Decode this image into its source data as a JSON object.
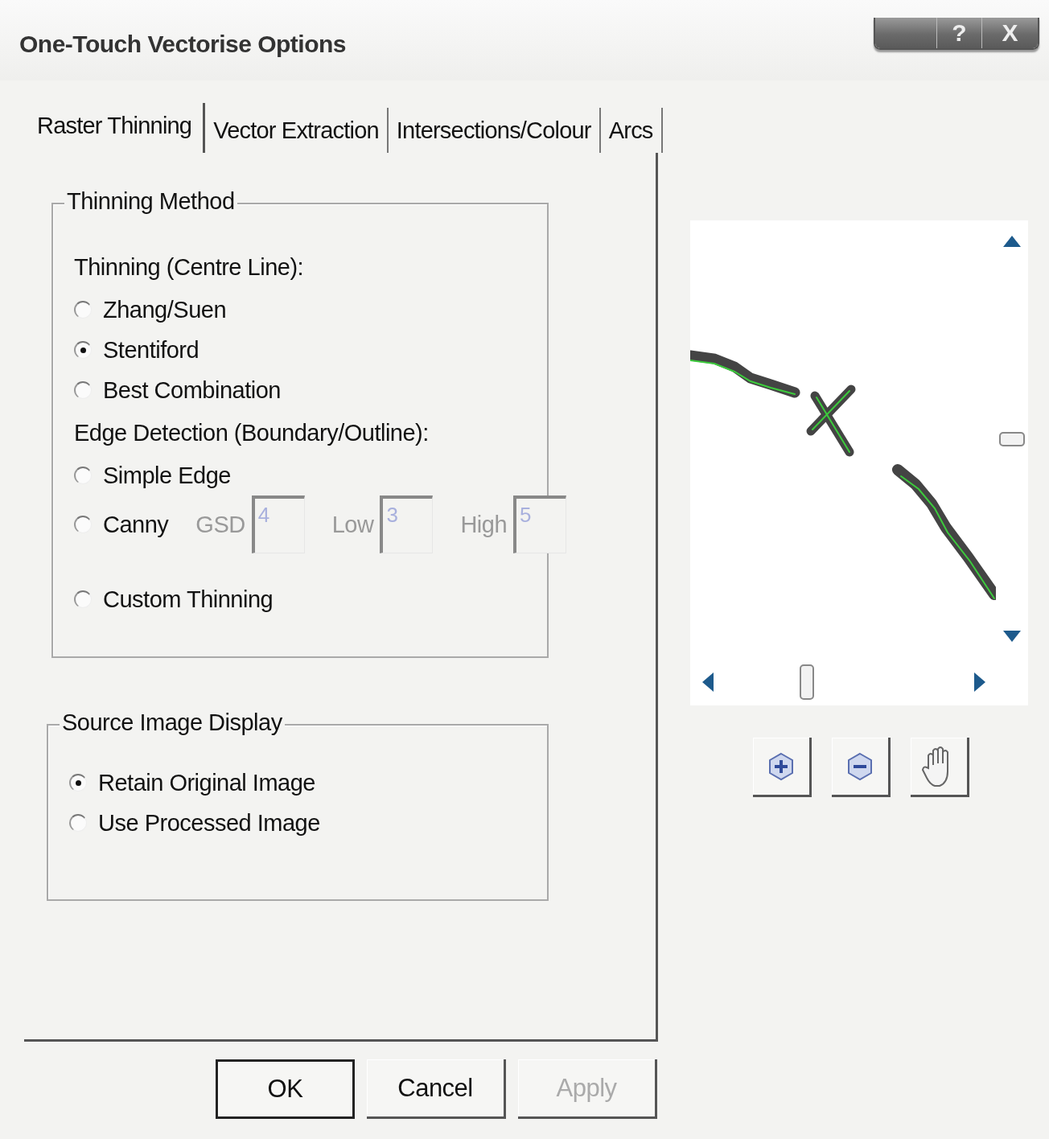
{
  "window": {
    "title": "One-Touch Vectorise Options"
  },
  "caption_buttons": [
    {
      "kind": "blank"
    },
    {
      "kind": "help",
      "label": "?"
    },
    {
      "kind": "close",
      "label": "X"
    }
  ],
  "tabs": [
    {
      "label": "Raster Thinning",
      "selected": true
    },
    {
      "label": "Vector Extraction",
      "selected": false
    },
    {
      "label": "Intersections/Colour",
      "selected": false
    },
    {
      "label": "Arcs",
      "selected": false
    }
  ],
  "thinning_method": {
    "title": "Thinning Method",
    "sections": [
      {
        "heading": "Thinning (Centre Line):",
        "options": [
          {
            "label": "Zhang/Suen",
            "selected": false
          },
          {
            "label": "Stentiford",
            "selected": true
          },
          {
            "label": "Best Combination",
            "selected": false
          }
        ]
      },
      {
        "heading": "Edge Detection (Boundary/Outline):",
        "options": [
          {
            "label": "Simple Edge",
            "selected": false
          },
          {
            "label": "Canny",
            "selected": false,
            "params": [
              {
                "label": "GSD",
                "value": "4",
                "disabled": true
              },
              {
                "label": "Low",
                "value": "3",
                "disabled": true
              },
              {
                "label": "High",
                "value": "5",
                "disabled": true
              }
            ]
          },
          {
            "label": "Custom Thinning",
            "selected": false
          }
        ]
      }
    ]
  },
  "source_image_display": {
    "title": "Source Image Display",
    "options": [
      {
        "label": "Retain Original Image",
        "selected": true
      },
      {
        "label": "Use Processed Image",
        "selected": false
      }
    ]
  },
  "buttons": [
    {
      "label": "OK",
      "default": true,
      "disabled": false
    },
    {
      "label": "Cancel",
      "default": false,
      "disabled": false
    },
    {
      "label": "Apply",
      "default": false,
      "disabled": true
    }
  ]
}
